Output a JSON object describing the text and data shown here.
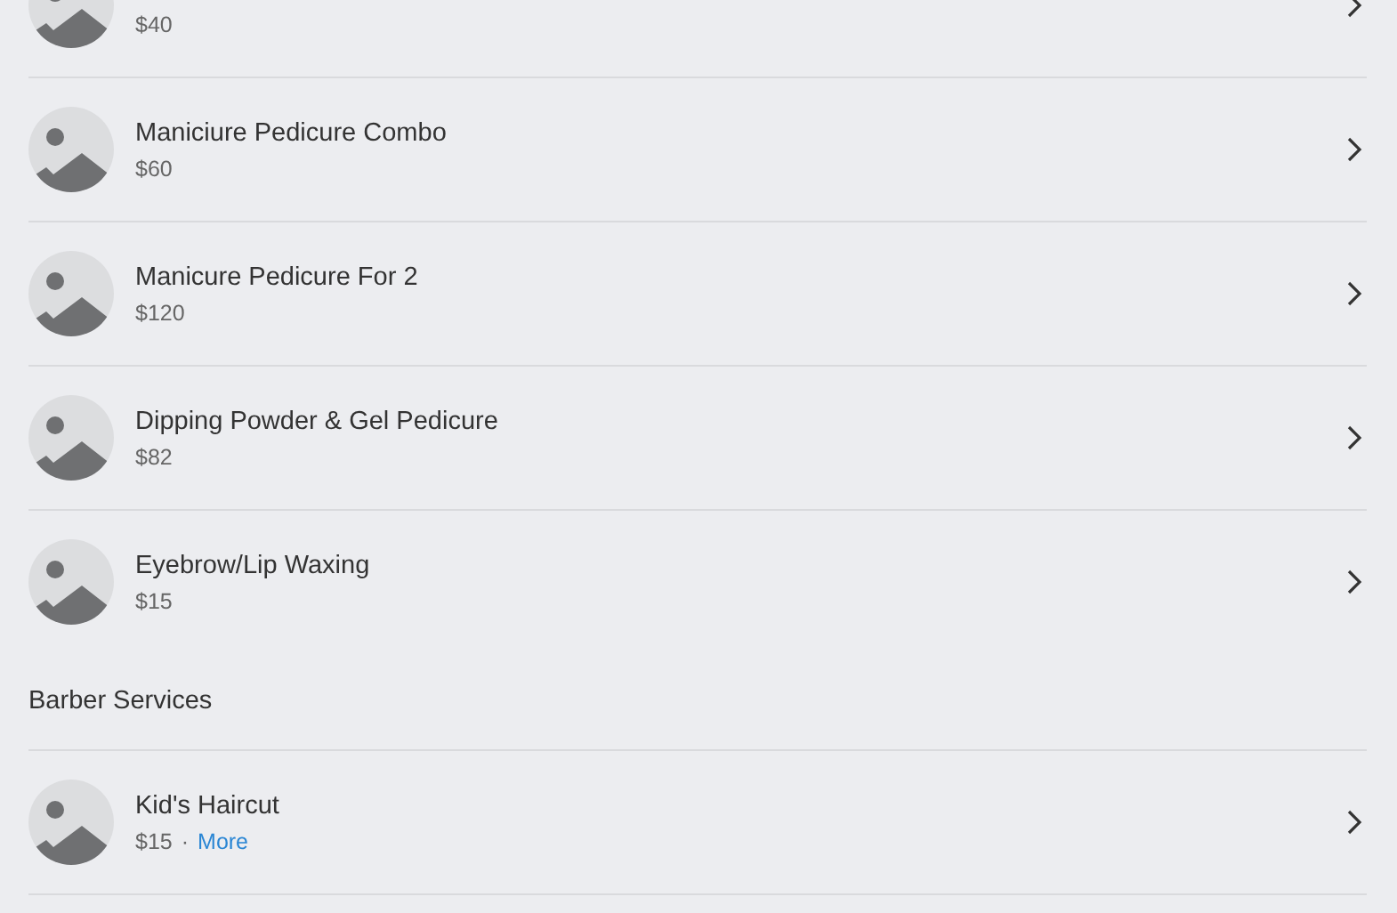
{
  "sections": [
    {
      "items": [
        {
          "price": "$40"
        },
        {
          "title": "Maniciure Pedicure Combo",
          "price": "$60"
        },
        {
          "title": "Manicure Pedicure For 2",
          "price": "$120"
        },
        {
          "title": "Dipping Powder & Gel Pedicure",
          "price": "$82"
        },
        {
          "title": "Eyebrow/Lip Waxing",
          "price": "$15"
        }
      ]
    },
    {
      "heading": "Barber Services",
      "items": [
        {
          "title": "Kid's Haircut",
          "price": "$15",
          "separator": "·",
          "link": "More"
        }
      ]
    }
  ]
}
